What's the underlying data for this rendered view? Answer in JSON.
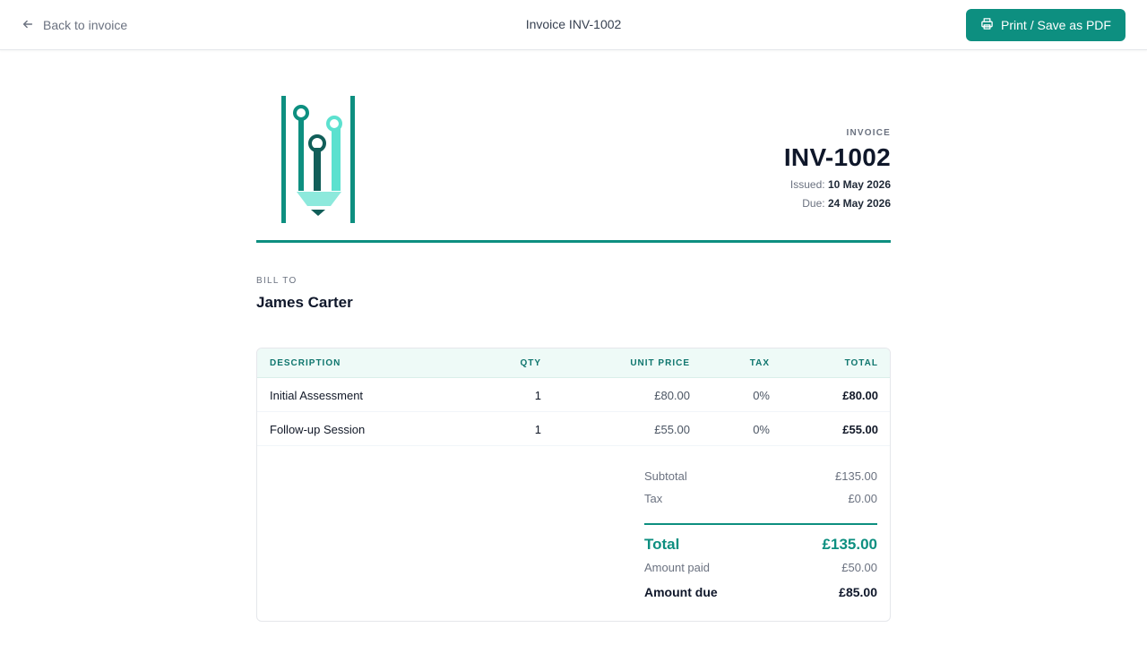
{
  "topbar": {
    "back_label": "Back to invoice",
    "title": "Invoice INV-1002",
    "print_label": "Print / Save as PDF"
  },
  "colors": {
    "accent": "#0d8f80",
    "accent_light": "#5ce1cf",
    "accent_dark": "#115e59"
  },
  "icons": {
    "back": "arrow-left-icon",
    "print": "printer-icon",
    "logo": "circuit-pencil-logo"
  },
  "invoice": {
    "kicker": "INVOICE",
    "number": "INV-1002",
    "issued_label": "Issued:",
    "issued": "10 May 2026",
    "due_label": "Due:",
    "due": "24 May 2026"
  },
  "bill_to": {
    "label": "BILL TO",
    "name": "James Carter"
  },
  "table": {
    "headers": {
      "description": "DESCRIPTION",
      "qty": "QTY",
      "unit_price": "UNIT PRICE",
      "tax": "TAX",
      "total": "TOTAL"
    },
    "rows": [
      {
        "description": "Initial Assessment",
        "qty": "1",
        "unit_price": "£80.00",
        "tax": "0%",
        "total": "£80.00"
      },
      {
        "description": "Follow-up Session",
        "qty": "1",
        "unit_price": "£55.00",
        "tax": "0%",
        "total": "£55.00"
      }
    ]
  },
  "totals": {
    "subtotal_label": "Subtotal",
    "subtotal": "£135.00",
    "tax_label": "Tax",
    "tax": "£0.00",
    "total_label": "Total",
    "total": "£135.00",
    "paid_label": "Amount paid",
    "paid": "£50.00",
    "due_label": "Amount due",
    "due": "£85.00"
  }
}
